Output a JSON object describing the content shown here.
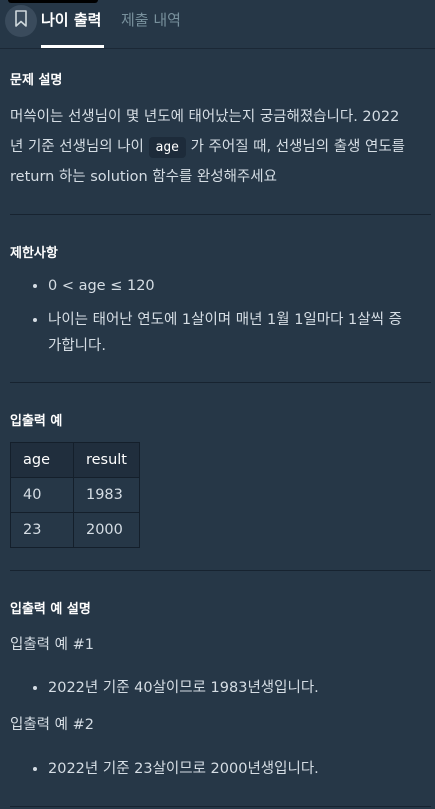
{
  "tabs": {
    "active": "나이 출력",
    "inactive": "제출 내역"
  },
  "description": {
    "heading": "문제 설명",
    "line1": "머쓱이는 선생님이 몇 년도에 태어났는지 궁금해졌습니다. 2022",
    "line2_a": "년 기준 선생님의 나이",
    "code": "age",
    "line2_b": "가 주어질 때, 선생님의 출생 연도를",
    "line3": "return 하는 solution 함수를 완성해주세요"
  },
  "constraints": {
    "heading": "제한사항",
    "items": [
      "0 < age ≤ 120",
      "나이는 태어난 연도에 1살이며 매년 1월 1일마다 1살씩 증",
      "가합니다."
    ]
  },
  "examples": {
    "heading": "입출력 예",
    "headers": [
      "age",
      "result"
    ],
    "rows": [
      [
        "40",
        "1983"
      ],
      [
        "23",
        "2000"
      ]
    ]
  },
  "explanation": {
    "heading": "입출력 예 설명",
    "ex1_title": "입출력 예 #1",
    "ex1_item": "2022년 기준 40살이므로 1983년생입니다.",
    "ex2_title": "입출력 예 #2",
    "ex2_item": "2022년 기준 23살이므로 2000년생입니다."
  }
}
